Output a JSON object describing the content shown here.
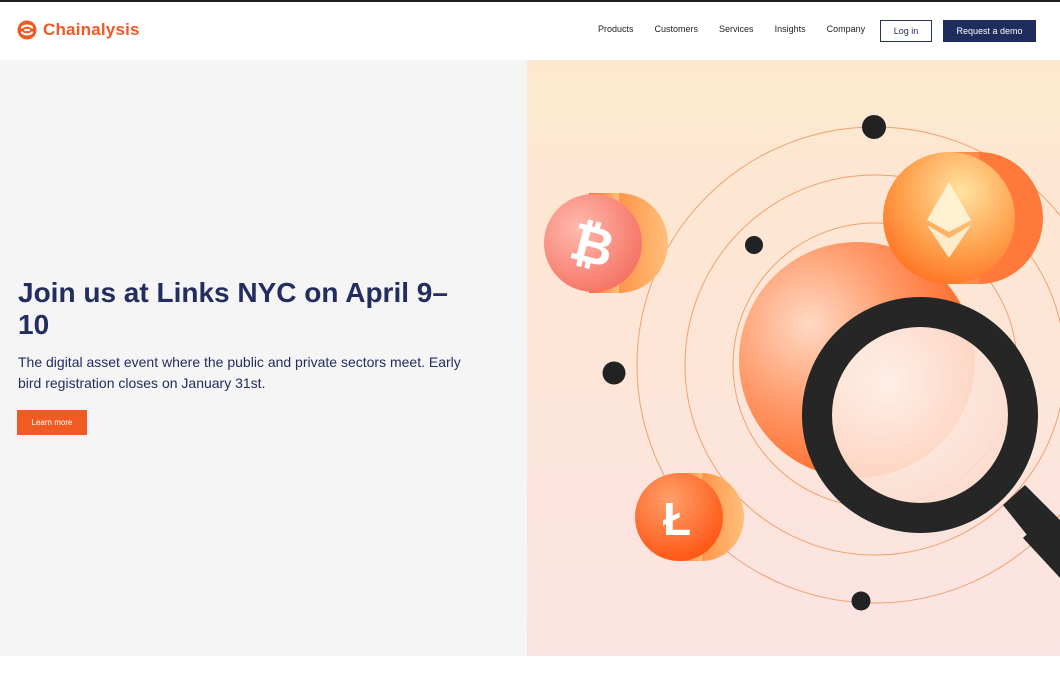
{
  "brand": {
    "name": "Chainalysis",
    "color": "#f15a22"
  },
  "nav": {
    "items": [
      "Products",
      "Customers",
      "Services",
      "Insights",
      "Company"
    ],
    "login_label": "Log in",
    "demo_label": "Request a demo"
  },
  "hero": {
    "title": "Join us at Links NYC on April 9–10",
    "subtitle": "The digital asset event where the public and private sectors meet. Early bird registration closes on January 31st.",
    "cta_label": "Learn more"
  },
  "colors": {
    "navy": "#1f2c5e",
    "orange": "#f15a22",
    "illustration_bg": "#fde8cf"
  },
  "illustration_icons": [
    "bitcoin-coin",
    "ethereum-coin",
    "litecoin-coin",
    "magnifying-glass",
    "orbit-rings"
  ]
}
